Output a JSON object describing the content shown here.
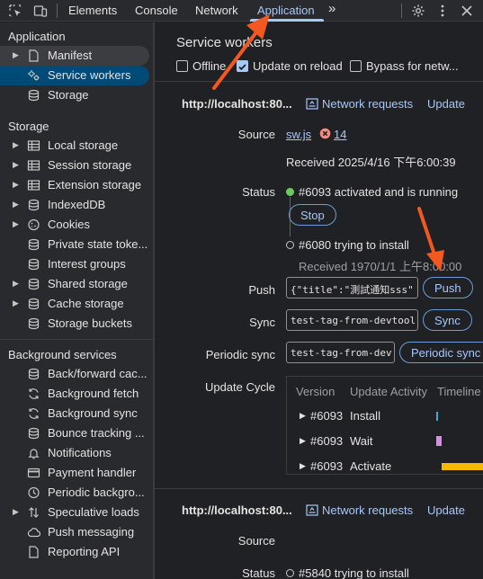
{
  "tabbar": {
    "tabs": [
      {
        "label": "Elements"
      },
      {
        "label": "Console"
      },
      {
        "label": "Network"
      },
      {
        "label": "Application"
      }
    ],
    "more": "»"
  },
  "sidebar": {
    "sections": [
      {
        "title": "Application"
      },
      {
        "title": "Storage"
      },
      {
        "title": "Background services"
      }
    ],
    "items": [
      {
        "label": "Manifest",
        "icon": "file-icon"
      },
      {
        "label": "Service workers",
        "icon": "gears-icon"
      },
      {
        "label": "Storage",
        "icon": "database-icon"
      },
      {
        "label": "Local storage",
        "icon": "table-icon"
      },
      {
        "label": "Session storage",
        "icon": "table-icon"
      },
      {
        "label": "Extension storage",
        "icon": "table-icon"
      },
      {
        "label": "IndexedDB",
        "icon": "database-icon"
      },
      {
        "label": "Cookies",
        "icon": "cookie-icon"
      },
      {
        "label": "Private state toke...",
        "icon": "database-icon"
      },
      {
        "label": "Interest groups",
        "icon": "database-icon"
      },
      {
        "label": "Shared storage",
        "icon": "database-icon"
      },
      {
        "label": "Cache storage",
        "icon": "database-icon"
      },
      {
        "label": "Storage buckets",
        "icon": "database-icon"
      },
      {
        "label": "Back/forward cac...",
        "icon": "database-icon"
      },
      {
        "label": "Background fetch",
        "icon": "sync-icon"
      },
      {
        "label": "Background sync",
        "icon": "sync-icon"
      },
      {
        "label": "Bounce tracking ...",
        "icon": "database-icon"
      },
      {
        "label": "Notifications",
        "icon": "bell-icon"
      },
      {
        "label": "Payment handler",
        "icon": "card-icon"
      },
      {
        "label": "Periodic backgro...",
        "icon": "clock-icon"
      },
      {
        "label": "Speculative loads",
        "icon": "arrows-icon"
      },
      {
        "label": "Push messaging",
        "icon": "cloud-icon"
      },
      {
        "label": "Reporting API",
        "icon": "file-icon"
      }
    ]
  },
  "main": {
    "title": "Service workers",
    "options": {
      "offline": "Offline",
      "update_on_reload": "Update on reload",
      "bypass": "Bypass for netw..."
    },
    "workers": [
      {
        "origin": "http://localhost:80...",
        "network_requests": "Network requests",
        "update": "Update",
        "source_label": "Source",
        "source_file": "sw.js",
        "error_count": "14",
        "received": "Received 2025/4/16 下午6:00:39",
        "status_label": "Status",
        "status_active": "#6093 activated and is running",
        "stop": "Stop",
        "status_installing": "#6080 trying to install",
        "installing_received": "Received 1970/1/1 上午8:00:00",
        "push_label": "Push",
        "push_value": "{\"title\":\"測試通知sss\"",
        "push_button": "Push",
        "sync_label": "Sync",
        "sync_value": "test-tag-from-devtool",
        "sync_button": "Sync",
        "periodic_label": "Periodic sync",
        "periodic_value": "test-tag-from-dev",
        "periodic_button": "Periodic sync",
        "cycle_label": "Update Cycle",
        "cycle_headers": [
          "Version",
          "Update Activity",
          "Timeline"
        ],
        "cycle_rows": [
          {
            "version": "#6093",
            "activity": "Install"
          },
          {
            "version": "#6093",
            "activity": "Wait"
          },
          {
            "version": "#6093",
            "activity": "Activate"
          }
        ]
      },
      {
        "origin": "http://localhost:80...",
        "network_requests": "Network requests",
        "update": "Update",
        "source_label": "Source",
        "status_label": "Status",
        "status_installing": "#5840 trying to install"
      }
    ]
  },
  "colors": {
    "accent": "#a8c7fa",
    "running": "#6ccb5f",
    "error": "#f28b82",
    "arrow": "#f2581f",
    "timeline_install": "#4ea3d8",
    "timeline_wait": "#d38fe0",
    "timeline_activate": "#f6b800"
  }
}
